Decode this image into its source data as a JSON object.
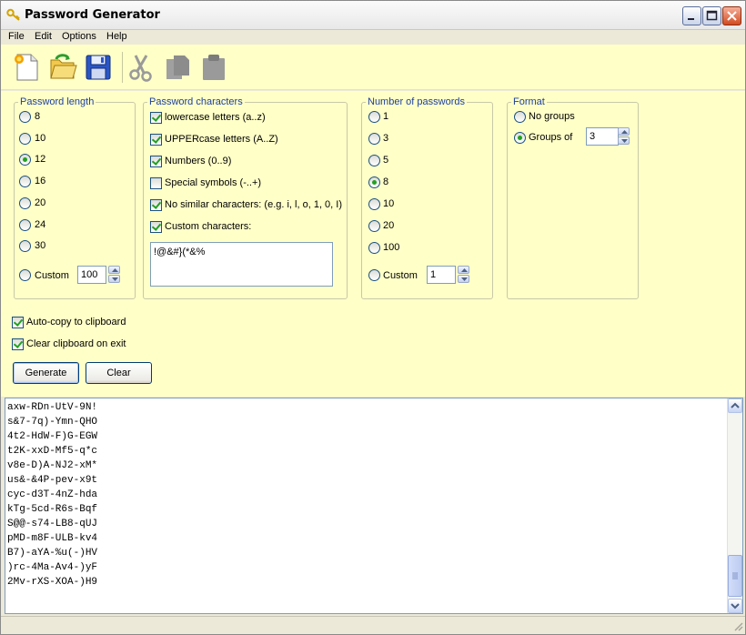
{
  "window": {
    "title": "Password Generator"
  },
  "menu": [
    "File",
    "Edit",
    "Options",
    "Help"
  ],
  "toolbar": {
    "tools": [
      "new-document-icon",
      "open-folder-icon",
      "save-disk-icon",
      "cut-scissors-icon",
      "copy-icon",
      "paste-icon"
    ]
  },
  "length": {
    "legend": "Password length",
    "options": [
      "8",
      "10",
      "12",
      "16",
      "20",
      "24",
      "30"
    ],
    "selected": "12",
    "custom_label": "Custom",
    "custom_value": "100"
  },
  "characters": {
    "legend": "Password characters",
    "options": [
      {
        "label": "lowercase letters (a..z)",
        "checked": true
      },
      {
        "label": "UPPERcase letters (A..Z)",
        "checked": true
      },
      {
        "label": "Numbers (0..9)",
        "checked": true
      },
      {
        "label": "Special symbols (-..+)",
        "checked": false
      },
      {
        "label": "No similar characters: (e.g. i, l, o, 1, 0, I)",
        "checked": true
      },
      {
        "label": "Custom characters:",
        "checked": true
      }
    ],
    "custom_chars": "!@&#}(*&%"
  },
  "count": {
    "legend": "Number of passwords",
    "options": [
      "1",
      "3",
      "5",
      "8",
      "10",
      "20",
      "100"
    ],
    "selected": "8",
    "custom_label": "Custom",
    "custom_value": "1"
  },
  "format": {
    "legend": "Format",
    "no_groups": "No groups",
    "groups_of": "Groups of",
    "selected": "groups",
    "group_size": "3"
  },
  "options": {
    "auto_copy": {
      "label": "Auto-copy to clipboard",
      "checked": true
    },
    "clear_on_exit": {
      "label": "Clear clipboard on exit",
      "checked": true
    }
  },
  "buttons": {
    "generate": "Generate",
    "clear": "Clear"
  },
  "output": [
    "axw-RDn-UtV-9N!",
    "s&7-7q)-Ymn-QHO",
    "4t2-HdW-F)G-EGW",
    "t2K-xxD-Mf5-q*c",
    "v8e-D)A-NJ2-xM*",
    "us&-&4P-pev-x9t",
    "cyc-d3T-4nZ-hda",
    "kTg-5cd-R6s-Bqf",
    "S@@-s74-LB8-qUJ",
    "pMD-m8F-ULB-kv4",
    "B7)-aYA-%u(-)HV",
    ")rc-4Ma-Av4-)yF",
    "2Mv-rXS-XOA-)H9"
  ]
}
